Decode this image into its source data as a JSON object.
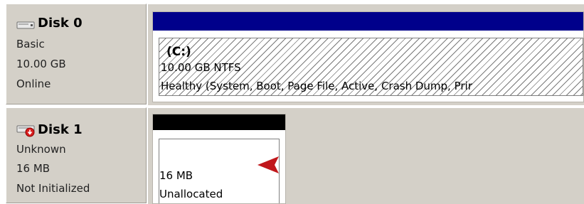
{
  "disks": [
    {
      "name": "Disk 0",
      "type": "Basic",
      "size": "10.00 GB",
      "status": "Online",
      "icon": "disk-online-icon",
      "volume": {
        "label": "(C:)",
        "size_fs": "10.00 GB NTFS",
        "health": "Healthy (System, Boot, Page File, Active, Crash Dump, Prir",
        "bar_color": "#00008b"
      }
    },
    {
      "name": "Disk 1",
      "type": "Unknown",
      "size": "16 MB",
      "status": "Not Initialized",
      "icon": "disk-error-icon",
      "volume": {
        "size": "16 MB",
        "state": "Unallocated",
        "bar_color": "#000000"
      }
    }
  ],
  "annotation": {
    "arrow_color": "#c0171b",
    "icon": "red-arrow-icon"
  }
}
